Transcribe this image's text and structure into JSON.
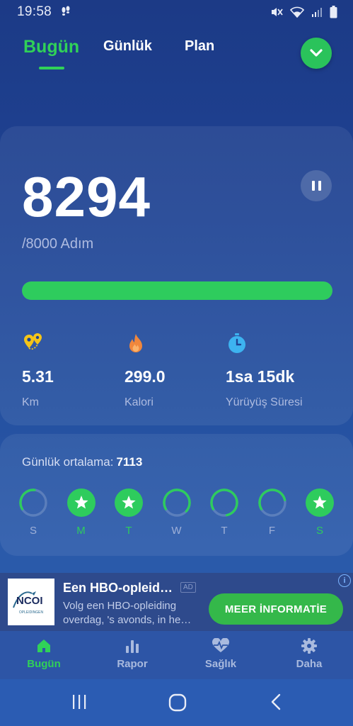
{
  "status_bar": {
    "time": "19:58",
    "icons": [
      "footsteps-icon",
      "mute-icon",
      "wifi-icon",
      "signal-icon",
      "battery-icon"
    ]
  },
  "top_tabs": [
    {
      "label": "Bugün",
      "active": true
    },
    {
      "label": "Günlük",
      "active": false
    },
    {
      "label": "Plan",
      "active": false
    }
  ],
  "menu_button_icon": "chevron-down-icon",
  "summary": {
    "steps": "8294",
    "goal_text": "/8000 Adım",
    "goal_progress_fraction": 1.0,
    "stats": [
      {
        "icon": "location-pin-icon",
        "value": "5.31",
        "label": "Km"
      },
      {
        "icon": "flame-icon",
        "value": "299.0",
        "label": "Kalori"
      },
      {
        "icon": "stopwatch-icon",
        "value": "1sa 15dk",
        "label": "Yürüyüş Süresi"
      }
    ]
  },
  "week": {
    "avg_label": "Günlük ortalama:",
    "avg_value": "7113",
    "days": [
      {
        "label": "S",
        "completed": false,
        "fraction": 0.35
      },
      {
        "label": "M",
        "completed": true,
        "fraction": 1.0
      },
      {
        "label": "T",
        "completed": true,
        "fraction": 1.0
      },
      {
        "label": "W",
        "completed": false,
        "fraction": 0.7
      },
      {
        "label": "T",
        "completed": false,
        "fraction": 0.8
      },
      {
        "label": "F",
        "completed": false,
        "fraction": 0.55
      },
      {
        "label": "S",
        "completed": true,
        "fraction": 1.0
      }
    ]
  },
  "ad": {
    "logo_text": "NCOI",
    "logo_sub": "OPLEIDINGEN",
    "title": "Een HBO-opleid…",
    "badge": "AD",
    "description": "Volg een HBO-opleiding overdag, 's avonds, in he…",
    "cta": "MEER İNFORMATİE",
    "info_icon": "info-icon"
  },
  "bottom_nav": [
    {
      "label": "Bugün",
      "icon": "home-icon",
      "active": true
    },
    {
      "label": "Rapor",
      "icon": "bar-chart-icon",
      "active": false
    },
    {
      "label": "Sağlık",
      "icon": "heart-pulse-icon",
      "active": false
    },
    {
      "label": "Daha",
      "icon": "gear-icon",
      "active": false
    }
  ],
  "system_nav": [
    "recents-icon",
    "home-circle-icon",
    "back-icon"
  ],
  "colors": {
    "accent_green": "#30d158",
    "background_top": "#1c3a86",
    "background_bottom": "#2b5dae"
  }
}
